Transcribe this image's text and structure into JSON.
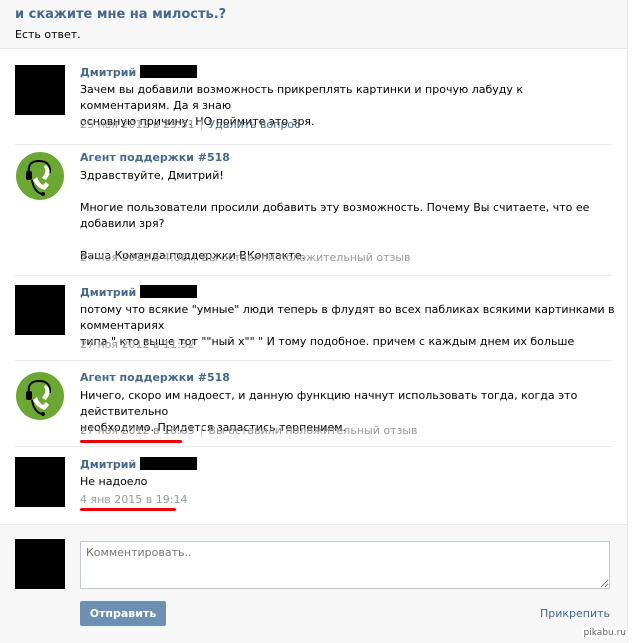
{
  "header": {
    "title": "и скажите мне на милость.?",
    "subtitle": "Есть ответ."
  },
  "messages": [
    {
      "author": "Дмитрий",
      "lines": [
        "Зачем вы добавили возможность прикреплять картинки и прочую лабуду к комментариям. Да я знаю",
        "основную причину. НО поймите это зря."
      ],
      "date": "25 ноя 2012 в 23:51",
      "action": "Удалить вопрос"
    },
    {
      "author": "Агент поддержки #518",
      "lines": [
        "Здравствуйте, Дмитрий!",
        "",
        "Многие пользователи просили добавить эту возможность. Почему Вы считаете, что ее добавили зря?",
        "",
        "Ваша Команда поддержки ВКонтакте."
      ],
      "date": "27 ноя 2012 в 4:06",
      "action": "Вы оставили положительный отзыв"
    },
    {
      "author": "Дмитрий",
      "lines": [
        "потому что всякие \"умные\" люди теперь в флудят во всех пабликах всякими картинками в комментариях",
        "типа \" кто выше тот \"\"ный х\"\" \" И тому подобное. причем с каждым днем их больше"
      ],
      "date": "27 ноя 2012 в 11:52"
    },
    {
      "author": "Агент поддержки #518",
      "lines": [
        "Ничего, скоро им надоест, и данную функцию начнут использовать тогда, когда это действительно",
        "необходимо. Придется запастись терпением."
      ],
      "date": "27 ноя 2012 в 16:05",
      "action": "Вы оставили положительный отзыв"
    },
    {
      "author": "Дмитрий",
      "lines": [
        "Не надоело"
      ],
      "date": "4 янв 2015 в 19:14"
    }
  ],
  "composer": {
    "placeholder": "Комментировать..",
    "send_label": "Отправить",
    "attach_label": "Прикрепить"
  },
  "watermark": "pikabu.ru",
  "colors": {
    "link": "#45688e",
    "meta": "#999999",
    "button": "#6d8fb3",
    "highlight": "#ee0000",
    "agent_logo": "#6aa832"
  }
}
